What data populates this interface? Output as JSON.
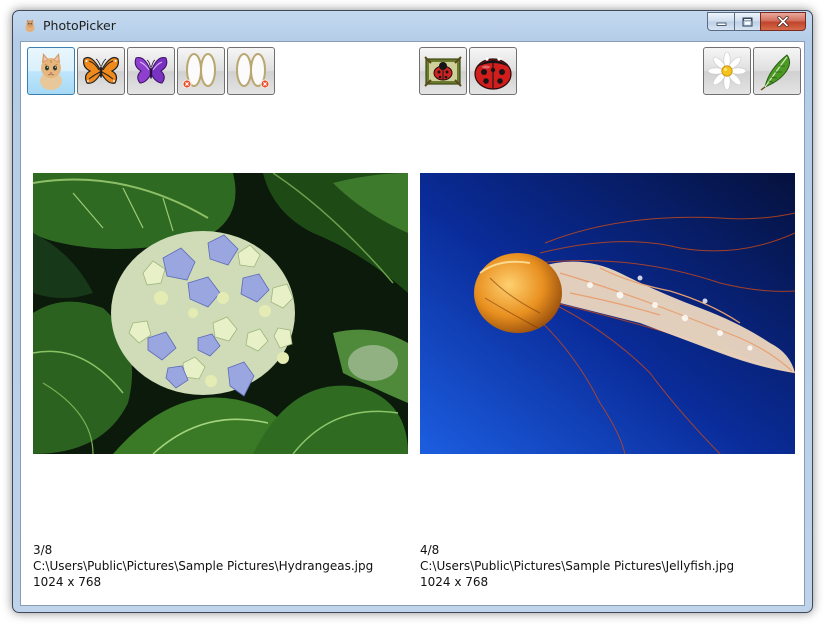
{
  "window": {
    "title": "PhotoPicker",
    "icons": {
      "app": "photopicker-app-icon",
      "minimize": "minimize-icon",
      "maximize": "maximize-icon",
      "close": "close-icon"
    }
  },
  "toolbar": {
    "left_buttons": [
      {
        "name": "kitten-button",
        "icon": "kitten-icon",
        "selected": true
      },
      {
        "name": "butterfly-button",
        "icon": "butterfly-icon",
        "selected": false
      },
      {
        "name": "purple-butterfly-button",
        "icon": "purple-butterfly-icon",
        "selected": false
      },
      {
        "name": "frames-left-button",
        "icon": "frames-icon",
        "selected": false
      },
      {
        "name": "frames-right-button",
        "icon": "frames-icon",
        "selected": false
      }
    ],
    "center_buttons": [
      {
        "name": "ladybug-small-button",
        "icon": "ladybug-frame-icon"
      },
      {
        "name": "ladybug-large-button",
        "icon": "ladybug-icon"
      }
    ],
    "right_buttons": [
      {
        "name": "daisy-button",
        "icon": "daisy-icon"
      },
      {
        "name": "feather-button",
        "icon": "feather-icon"
      }
    ]
  },
  "left_photo": {
    "subject": "hydrangea-photo",
    "index": "3/8",
    "path": "C:\\Users\\Public\\Pictures\\Sample Pictures\\Hydrangeas.jpg",
    "dimensions": "1024 x 768"
  },
  "right_photo": {
    "subject": "jellyfish-photo",
    "index": "4/8",
    "path": "C:\\Users\\Public\\Pictures\\Sample Pictures\\Jellyfish.jpg",
    "dimensions": "1024 x 768"
  }
}
